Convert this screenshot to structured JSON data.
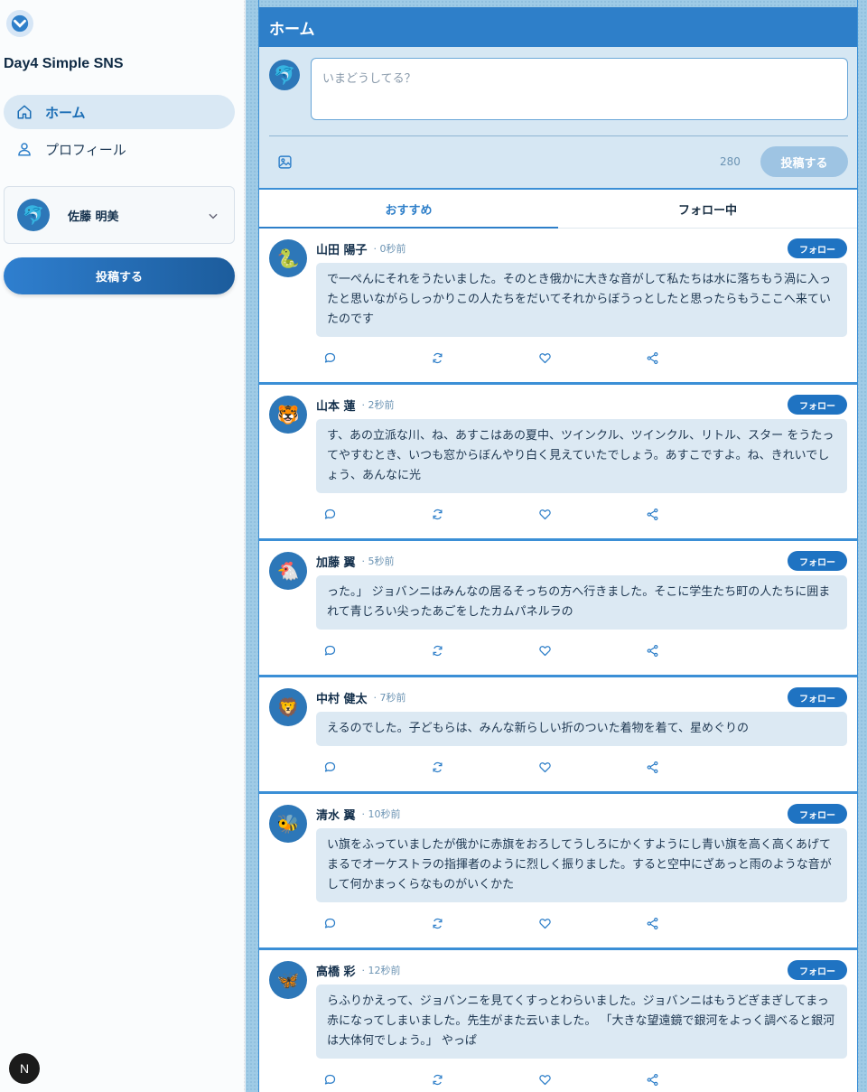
{
  "app": {
    "name": "Day4 Simple SNS"
  },
  "nav": {
    "items": [
      {
        "label": "ホーム",
        "icon": "home-icon",
        "active": true
      },
      {
        "label": "プロフィール",
        "icon": "user-icon",
        "active": false
      }
    ]
  },
  "account": {
    "name": "佐藤 明美",
    "avatar": "🐬"
  },
  "sidebar": {
    "post_label": "投稿する",
    "badge": "N"
  },
  "header": {
    "title": "ホーム"
  },
  "compose": {
    "avatar": "🐬",
    "placeholder": "いまどうしてる？",
    "char_count": "280",
    "post_label": "投稿する"
  },
  "tabs": [
    {
      "label": "おすすめ",
      "active": true
    },
    {
      "label": "フォロー中",
      "active": false
    }
  ],
  "posts": [
    {
      "name": "山田 陽子",
      "time": "· 0秒前",
      "avatar": "🐍",
      "follow": "フォロー",
      "text": "で一ぺんにそれをうたいました。そのとき俄かに大きな音がして私たちは水に落ちもう渦に入ったと思いながらしっかりこの人たちをだいてそれからぼうっとしたと思ったらもうここへ来ていたのです"
    },
    {
      "name": "山本 蓮",
      "time": "· 2秒前",
      "avatar": "🐯",
      "follow": "フォロー",
      "text": "す、あの立派な川、ね、あすこはあの夏中、ツインクル、ツインクル、リトル、スター をうたってやすむとき、いつも窓からぼんやり白く見えていたでしょう。あすこですよ。ね、きれいでしょう、あんなに光"
    },
    {
      "name": "加藤 翼",
      "time": "· 5秒前",
      "avatar": "🐔",
      "follow": "フォロー",
      "text": "った。」 ジョバンニはみんなの居るそっちの方へ行きました。そこに学生たち町の人たちに囲まれて青じろい尖ったあごをしたカムパネルラの"
    },
    {
      "name": "中村 健太",
      "time": "· 7秒前",
      "avatar": "🦁",
      "follow": "フォロー",
      "text": "えるのでした。子どもらは、みんな新らしい折のついた着物を着て、星めぐりの"
    },
    {
      "name": "清水 翼",
      "time": "· 10秒前",
      "avatar": "🐝",
      "follow": "フォロー",
      "text": "い旗をふっていましたが俄かに赤旗をおろしてうしろにかくすようにし青い旗を高く高くあげてまるでオーケストラの指揮者のように烈しく振りました。すると空中にざあっと雨のような音がして何かまっくらなものがいくかた"
    },
    {
      "name": "高橋 彩",
      "time": "· 12秒前",
      "avatar": "🦋",
      "follow": "フォロー",
      "text": "らふりかえって、ジョバンニを見てくすっとわらいました。ジョバンニはもうどぎまぎしてまっ赤になってしまいました。先生がまた云いました。 「大きな望遠鏡で銀河をよっく調べると銀河は大体何でしょう。」 やっぱ"
    }
  ],
  "post_actions": [
    "comment-icon",
    "repost-icon",
    "heart-icon",
    "share-icon"
  ],
  "colors": {
    "accent": "#2e7fc9",
    "follow": "#1f73c2",
    "post_body_bg": "#dce9f3",
    "background": "#9fcbe6"
  }
}
